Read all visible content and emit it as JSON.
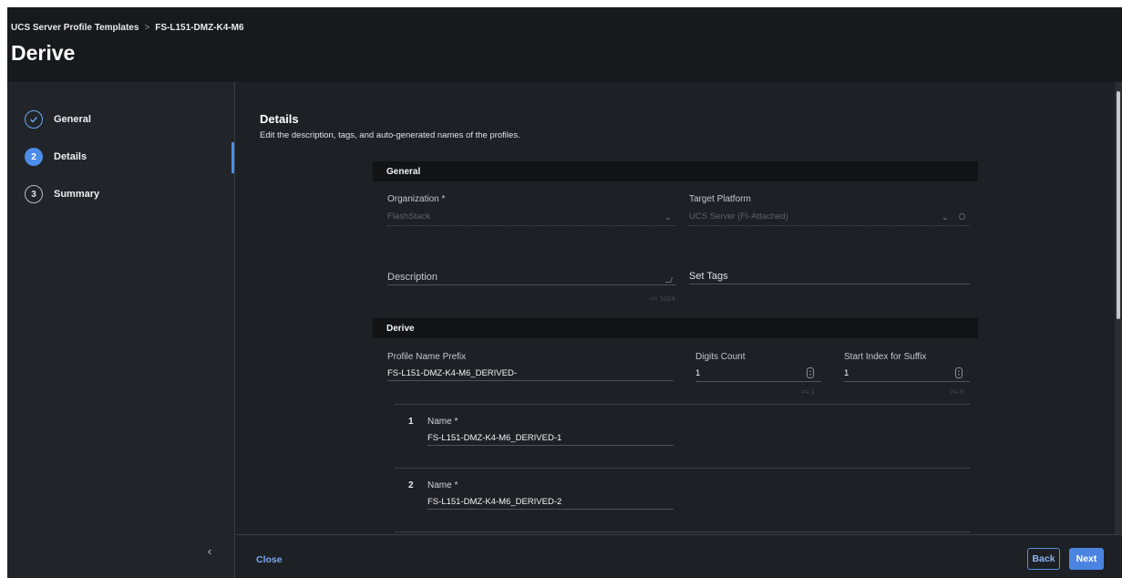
{
  "breadcrumb": {
    "parent": "UCS Server Profile Templates",
    "separator": ">",
    "current": "FS-L151-DMZ-K4-M6"
  },
  "page_title": "Derive",
  "steps": [
    {
      "number": "",
      "label": "General",
      "state": "done"
    },
    {
      "number": "2",
      "label": "Details",
      "state": "active"
    },
    {
      "number": "3",
      "label": "Summary",
      "state": "todo"
    }
  ],
  "section": {
    "title": "Details",
    "subtitle": "Edit the description, tags, and auto-generated names of the profiles."
  },
  "general_band": {
    "label": "General"
  },
  "organization": {
    "label": "Organization *",
    "value": "FlashStack"
  },
  "target_platform": {
    "label": "Target Platform",
    "value": "UCS Server (FI-Attached)"
  },
  "description": {
    "label": "Description",
    "hint": "<= 1024"
  },
  "set_tags": {
    "label": "Set Tags"
  },
  "derive_band": {
    "label": "Derive"
  },
  "profile_name_prefix": {
    "label": "Profile Name Prefix",
    "value": "FS-L151-DMZ-K4-M6_DERIVED-"
  },
  "digits_count": {
    "label": "Digits Count",
    "value": "1",
    "hint": ">= 1"
  },
  "start_index": {
    "label": "Start Index for Suffix",
    "value": "1",
    "hint": ">= 0"
  },
  "derived_names": [
    {
      "number": "1",
      "label": "Name *",
      "value": "FS-L151-DMZ-K4-M6_DERIVED-1"
    },
    {
      "number": "2",
      "label": "Name *",
      "value": "FS-L151-DMZ-K4-M6_DERIVED-2"
    }
  ],
  "footer": {
    "close": "Close",
    "back": "Back",
    "next": "Next"
  },
  "icons": {
    "collapse": "chevron-left-icon",
    "done_step": "check-circle-icon"
  },
  "colors": {
    "accent": "#4b84e0",
    "background": "#1d2024",
    "header": "#17191c"
  }
}
